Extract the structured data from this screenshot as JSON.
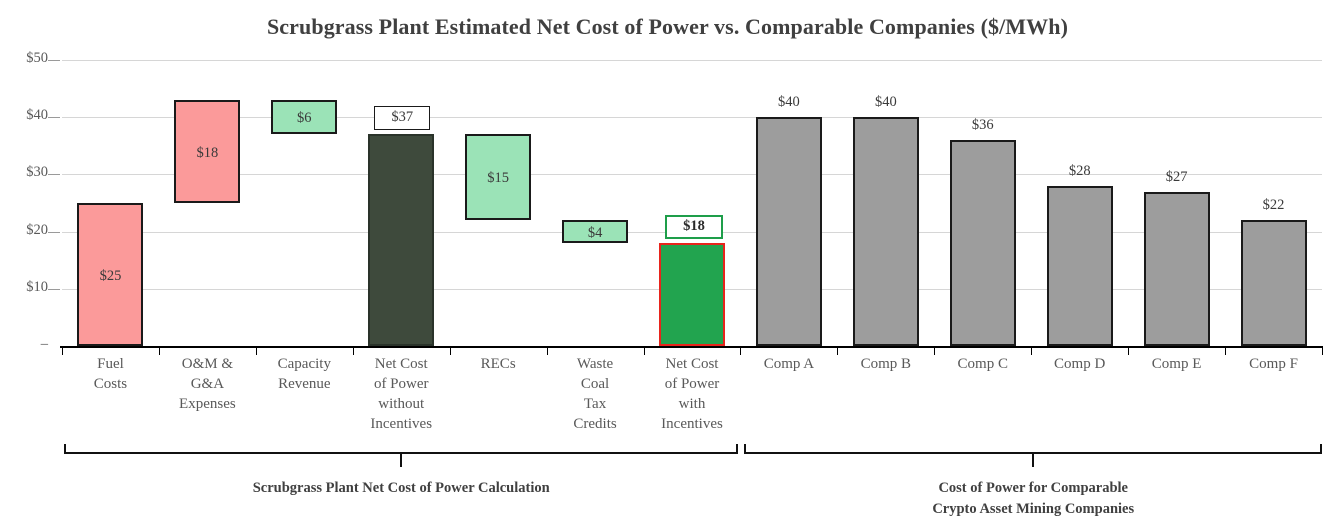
{
  "chart_data": {
    "type": "bar",
    "title": "Scrubgrass Plant Estimated Net Cost of Power vs. Comparable Companies ($/MWh)",
    "xlabel": "",
    "ylabel": "",
    "ylim": [
      0,
      50
    ],
    "grid": true,
    "legend": "none",
    "y_ticks": [
      {
        "value": 50,
        "label": "$50"
      },
      {
        "value": 40,
        "label": "$40"
      },
      {
        "value": 30,
        "label": "$30"
      },
      {
        "value": 20,
        "label": "$20"
      },
      {
        "value": 10,
        "label": "$10"
      },
      {
        "value": 0,
        "label": "–"
      }
    ],
    "categories": [
      "Fuel\nCosts",
      "O&M &\nG&A\nExpenses",
      "Capacity\nRevenue",
      "Net Cost\nof Power\nwithout\nIncentives",
      "RECs",
      "Waste\nCoal\nTax\nCredits",
      "Net Cost\nof Power\nwith\nIncentives",
      "Comp A",
      "Comp B",
      "Comp C",
      "Comp D",
      "Comp E",
      "Comp F"
    ],
    "values": [
      25,
      18,
      6,
      37,
      15,
      4,
      18,
      40,
      40,
      36,
      28,
      27,
      22
    ],
    "bars": [
      {
        "category": "Fuel Costs",
        "label": "$25",
        "value": 25,
        "base": 0,
        "top": 25,
        "kind": "increase",
        "label_pos": "inside"
      },
      {
        "category": "O&M & G&A Expenses",
        "label": "$18",
        "value": 18,
        "base": 25,
        "top": 43,
        "kind": "increase",
        "label_pos": "inside"
      },
      {
        "category": "Capacity Revenue",
        "label": "$6",
        "value": 6,
        "base": 37,
        "top": 43,
        "kind": "decrease",
        "label_pos": "inside"
      },
      {
        "category": "Net Cost of Power without Incentives",
        "label": "$37",
        "value": 37,
        "base": 0,
        "top": 37,
        "kind": "total",
        "label_pos": "above-box"
      },
      {
        "category": "RECs",
        "label": "$15",
        "value": 15,
        "base": 22,
        "top": 37,
        "kind": "decrease",
        "label_pos": "inside"
      },
      {
        "category": "Waste Coal Tax Credits",
        "label": "$4",
        "value": 4,
        "base": 18,
        "top": 22,
        "kind": "decrease",
        "label_pos": "inside"
      },
      {
        "category": "Net Cost of Power with Incentives",
        "label": "$18",
        "value": 18,
        "base": 0,
        "top": 18,
        "kind": "total-highlight",
        "label_pos": "above-box-green"
      },
      {
        "category": "Comp A",
        "label": "$40",
        "value": 40,
        "base": 0,
        "top": 40,
        "kind": "comparable",
        "label_pos": "above"
      },
      {
        "category": "Comp B",
        "label": "$40",
        "value": 40,
        "base": 0,
        "top": 40,
        "kind": "comparable",
        "label_pos": "above"
      },
      {
        "category": "Comp C",
        "label": "$36",
        "value": 36,
        "base": 0,
        "top": 36,
        "kind": "comparable",
        "label_pos": "above"
      },
      {
        "category": "Comp D",
        "label": "$28",
        "value": 28,
        "base": 0,
        "top": 28,
        "kind": "comparable",
        "label_pos": "above"
      },
      {
        "category": "Comp E",
        "label": "$27",
        "value": 27,
        "base": 0,
        "top": 27,
        "kind": "comparable",
        "label_pos": "above"
      },
      {
        "category": "Comp F",
        "label": "$22",
        "value": 22,
        "base": 0,
        "top": 22,
        "kind": "comparable",
        "label_pos": "above"
      }
    ],
    "annotations": [
      {
        "name": "left-bracket",
        "caption": "Scrubgrass Plant Net Cost of Power Calculation",
        "from_category": "Fuel Costs",
        "to_category": "Net Cost of Power with Incentives"
      },
      {
        "name": "right-bracket",
        "caption_line1": "Cost of Power for Comparable",
        "caption_line2": "Crypto Asset Mining Companies",
        "from_category": "Comp A",
        "to_category": "Comp F"
      }
    ],
    "colors": {
      "increase": "#FB9A9A",
      "decrease": "#9BE3B7",
      "total": "#3E4A3C",
      "total_highlight_fill": "#22A44F",
      "total_highlight_border": "#E8241C",
      "comparable": "#9D9D9D",
      "gridline": "#D6D6D6",
      "text": "#595959",
      "title": "#404040"
    }
  }
}
